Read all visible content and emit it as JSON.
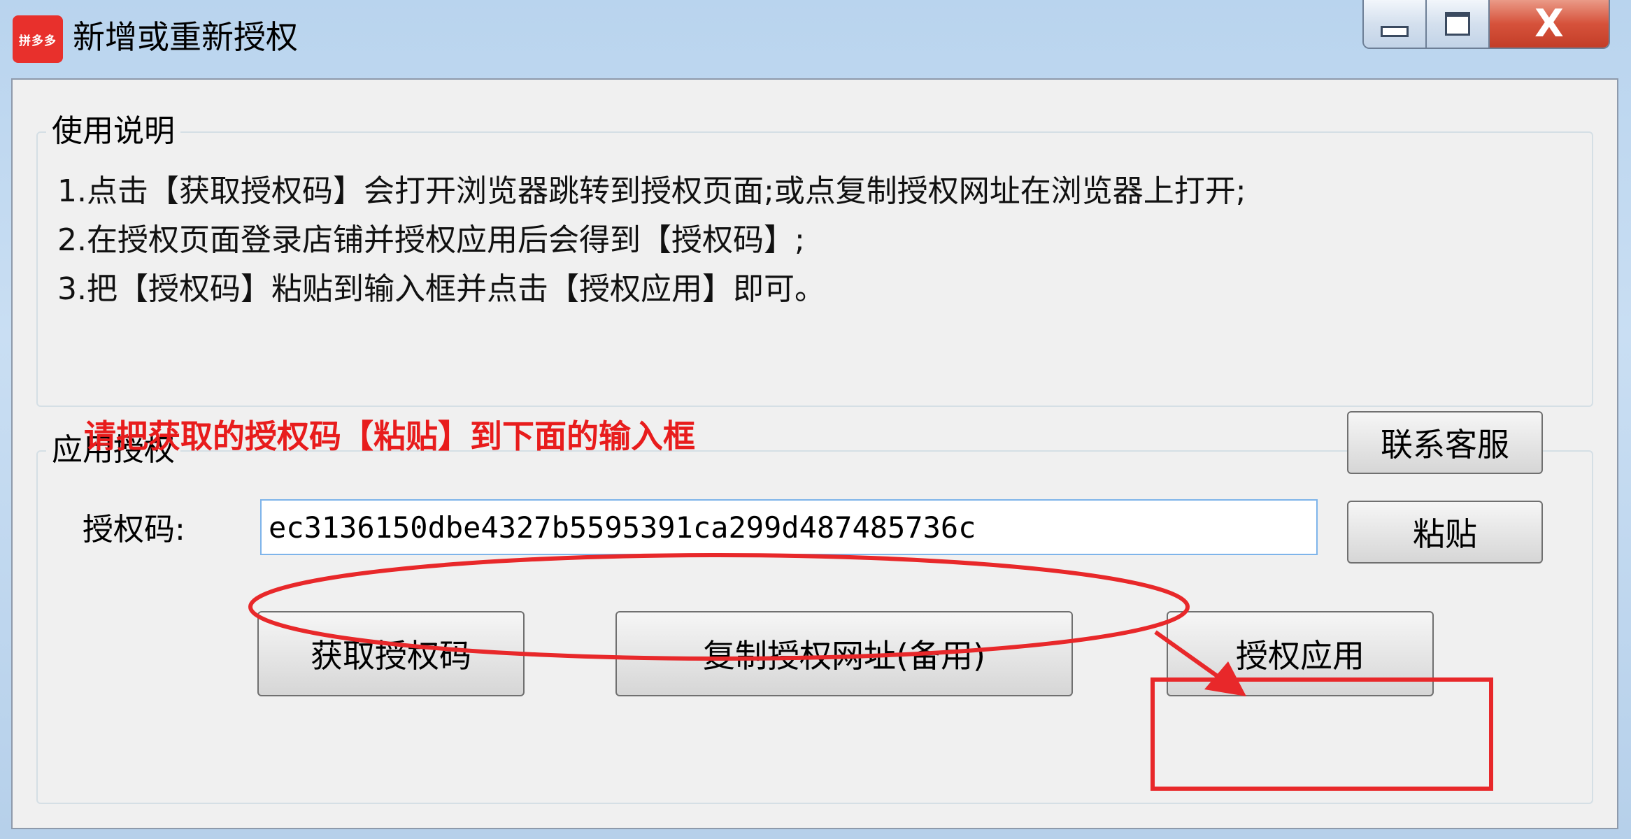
{
  "window": {
    "title": "新增或重新授权",
    "icon_text": "拼多多",
    "icon_color": "#e8302c",
    "controls": {
      "minimize_icon": "minimize-icon",
      "maximize_icon": "maximize-icon",
      "close_icon": "close-icon",
      "close_glyph": "X"
    }
  },
  "usage": {
    "legend": "使用说明",
    "lines": [
      "1.点击【获取授权码】会打开浏览器跳转到授权页面;或点复制授权网址在浏览器上打开;",
      "2.在授权页面登录店铺并授权应用后会得到【授权码】;",
      "3.把【授权码】粘贴到输入框并点击【授权应用】即可。"
    ]
  },
  "auth": {
    "legend": "应用授权",
    "hint": "请把获取的授权码【粘贴】到下面的输入框",
    "hint_color": "#e81c1c",
    "code_label": "授权码:",
    "code_value": "ec3136150dbe4327b5595391ca299d487485736c",
    "buttons": {
      "contact": "联系客服",
      "paste": "粘贴",
      "get_code": "获取授权码",
      "copy_url": "复制授权网址(备用)",
      "apply": "授权应用"
    }
  },
  "annotation_color": "#e8282a"
}
